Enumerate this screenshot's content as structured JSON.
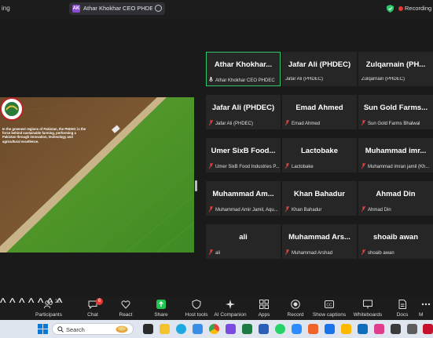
{
  "topbar": {
    "left_text": "ing",
    "share_avatar": "AK",
    "share_title": "Athar Khokhar CEO PHDEC's scre",
    "recording_label": "Recording"
  },
  "slide": {
    "text": "In the greenest regions of Pakistan, the PHDEC is the force behind sustainable farming, performing a Pakistan through innovation, technology and agricultural excellence."
  },
  "participants": [
    {
      "name": "Athar  Khokhar...",
      "label": "Athar Khokhar CEO PHDEC",
      "active": true,
      "mic": "unmuted"
    },
    {
      "name": "Jafar Ali (PHDEC)",
      "label": "Jafar Ali (PHDEC)",
      "active": false,
      "mic": "none"
    },
    {
      "name": "Zulqarnain  (PH...",
      "label": "Zulqarnain (PHDEC)",
      "active": false,
      "mic": "none"
    },
    {
      "name": "Jafar Ali (PHDEC)",
      "label": "Jafar Ali (PHDEC)",
      "active": false,
      "mic": "muted"
    },
    {
      "name": "Emad Ahmed",
      "label": "Emad Ahmed",
      "active": false,
      "mic": "muted"
    },
    {
      "name": "Sun Gold Farms...",
      "label": "Sun Gold Farms Bhalwal",
      "active": false,
      "mic": "muted"
    },
    {
      "name": "Umer SixB Food...",
      "label": "Umer SixB Food Industries P...",
      "active": false,
      "mic": "muted"
    },
    {
      "name": "Lactobake",
      "label": "Lactobake",
      "active": false,
      "mic": "muted"
    },
    {
      "name": "Muhammad  imr...",
      "label": "Muhammad imran jamil (Kh...",
      "active": false,
      "mic": "muted"
    },
    {
      "name": "Muhammad  Am...",
      "label": "Muhammad Amir Jamil, Aqu...",
      "active": false,
      "mic": "muted"
    },
    {
      "name": "Khan Bahadur",
      "label": "Khan Bahadur",
      "active": false,
      "mic": "muted"
    },
    {
      "name": "Ahmad Din",
      "label": "Ahmad Din",
      "active": false,
      "mic": "muted"
    },
    {
      "name": "ali",
      "label": "ali",
      "active": false,
      "mic": "muted"
    },
    {
      "name": "Muhammad  Ars...",
      "label": "Muhammad Arshad",
      "active": false,
      "mic": "muted"
    },
    {
      "name": "shoaib awan",
      "label": "shoaib awan",
      "active": false,
      "mic": "muted"
    }
  ],
  "toolbar": {
    "participants_label": "Participants",
    "participants_count": "20",
    "chat_label": "Chat",
    "chat_badge": "6",
    "react_label": "React",
    "share_label": "Share",
    "host_tools_label": "Host tools",
    "ai_label": "AI Companion",
    "apps_label": "Apps",
    "record_label": "Record",
    "captions_label": "Show captions",
    "whiteboards_label": "Whiteboards",
    "docs_label": "Docs",
    "more_label": "M"
  },
  "taskbar": {
    "search_placeholder": "Search"
  }
}
